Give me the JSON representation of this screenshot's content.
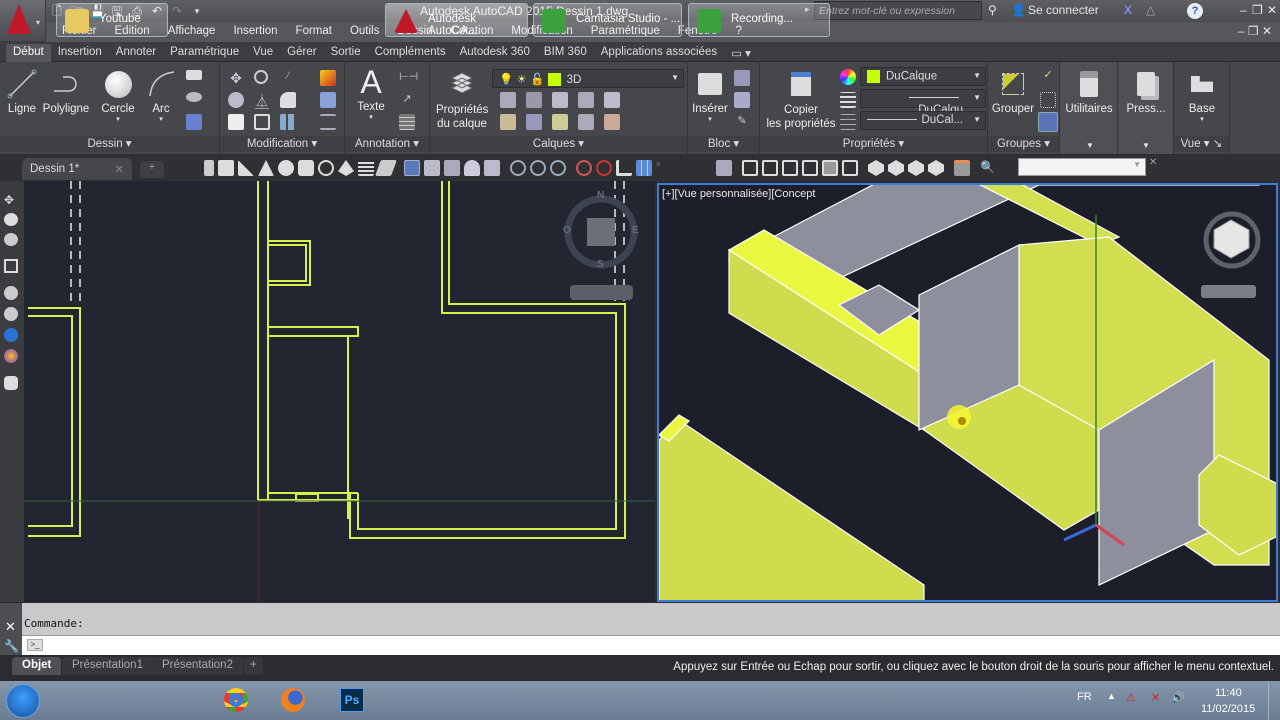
{
  "app": {
    "title": "Autodesk AutoCAD 2015   Dessin 1.dwg",
    "search_placeholder": "Entrez mot-clé ou expression",
    "sign_in": "Se connecter",
    "help": "?"
  },
  "menubar": [
    "Fichier",
    "Edition",
    "Affichage",
    "Insertion",
    "Format",
    "Outils",
    "Dessin",
    "Cotation",
    "Modification",
    "Paramétrique",
    "Fenêtre",
    "?"
  ],
  "ribbon_tabs": [
    "Début",
    "Insertion",
    "Annoter",
    "Paramétrique",
    "Vue",
    "Gérer",
    "Sortie",
    "Compléments",
    "Autodesk 360",
    "BIM 360",
    "Applications associées"
  ],
  "active_ribbon_tab": "Début",
  "ribbon": {
    "dessin": {
      "title": "Dessin",
      "tools": [
        "Ligne",
        "Polyligne",
        "Cercle",
        "Arc"
      ]
    },
    "modification": {
      "title": "Modification"
    },
    "annotation": {
      "title": "Annotation",
      "texte": "Texte"
    },
    "calques": {
      "title": "Calques",
      "layer_props": "Propriétés du calque",
      "layer_props_l1": "Propriétés",
      "layer_props_l2": "du calque",
      "current_layer": "3D",
      "layer_color": "#c6ff00"
    },
    "bloc": {
      "title": "Bloc",
      "inserer": "Insérer"
    },
    "proprietes": {
      "title": "Propriétés",
      "copier_l1": "Copier",
      "copier_l2": "les propriétés",
      "color": "DuCalque",
      "linetype": "DuCalqu",
      "lineweight": "DuCal..."
    },
    "groupes": {
      "title": "Groupes",
      "grouper": "Grouper"
    },
    "utilitaires": {
      "title": "Utilitaires"
    },
    "presse": {
      "title": "Press..."
    },
    "vue": {
      "title": "Vue",
      "base": "Base"
    }
  },
  "doc_tabs": [
    {
      "label": "Dessin 1*",
      "active": true
    }
  ],
  "viewport_right_label": "[+][Vue personnalisée][Concept",
  "compass": {
    "n": "N",
    "s": "S",
    "e": "E",
    "o": "O"
  },
  "command": {
    "history": "Commande:",
    "input": ""
  },
  "layout_tabs": [
    "Objet",
    "Présentation1",
    "Présentation2"
  ],
  "active_layout_tab": "Objet",
  "status_message": "Appuyez sur Entrée ou Echap pour sortir, ou cliquez avec le bouton droit de la souris pour afficher le menu contextuel.",
  "taskbar": {
    "buttons": [
      {
        "label": "Youtube",
        "icon": "folder-icon"
      },
      {
        "label": "",
        "icon": "chrome-icon"
      },
      {
        "label": "",
        "icon": "firefox-icon"
      },
      {
        "label": "",
        "icon": "photoshop-icon"
      },
      {
        "label": "Autodesk AutoCA...",
        "icon": "autocad-icon"
      },
      {
        "label": "Camtasia Studio - ...",
        "icon": "camtasia-icon"
      },
      {
        "label": "Recording...",
        "icon": "camtasia-icon"
      }
    ],
    "lang": "FR",
    "time": "11:40",
    "date": "11/02/2015"
  }
}
